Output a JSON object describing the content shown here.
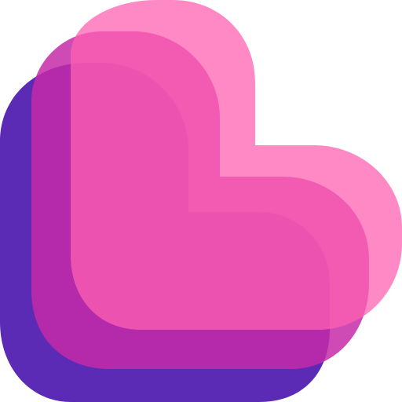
{
  "logo": {
    "name": "layered-rounded-l-heart-logo",
    "layers": [
      {
        "name": "back-layer",
        "color": "#5B2BB5"
      },
      {
        "name": "middle-layer",
        "color": "#C62AA8",
        "opacity": 0.85
      },
      {
        "name": "front-layer",
        "color": "#FF62B2",
        "opacity": 0.75
      }
    ]
  }
}
